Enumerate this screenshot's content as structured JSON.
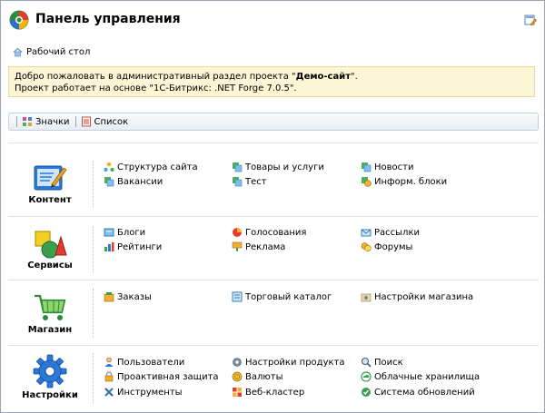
{
  "header": {
    "title": "Панель управления"
  },
  "breadcrumb": {
    "label": "Рабочий стол"
  },
  "notice": {
    "line1_prefix": "Добро пожаловать в административный раздел проекта \"",
    "project": "Демо-сайт",
    "line1_suffix": "\".",
    "line2": "Проект работает на основе \"1С-Битрикс: .NET Forge 7.0.5\"."
  },
  "toolbar": {
    "icons_label": "Значки",
    "list_label": "Список"
  },
  "sections": [
    {
      "label": "Контент",
      "items": [
        {
          "label": "Структура сайта",
          "icon": "structure-icon"
        },
        {
          "label": "Товары и услуги",
          "icon": "goods-icon"
        },
        {
          "label": "Новости",
          "icon": "news-icon"
        },
        {
          "label": "Вакансии",
          "icon": "vacancies-icon"
        },
        {
          "label": "Тест",
          "icon": "test-icon"
        },
        {
          "label": "Информ. блоки",
          "icon": "iblocks-icon"
        }
      ]
    },
    {
      "label": "Сервисы",
      "items": [
        {
          "label": "Блоги",
          "icon": "blogs-icon"
        },
        {
          "label": "Голосования",
          "icon": "votes-icon"
        },
        {
          "label": "Рассылки",
          "icon": "mailing-icon"
        },
        {
          "label": "Рейтинги",
          "icon": "ratings-icon"
        },
        {
          "label": "Реклама",
          "icon": "ads-icon"
        },
        {
          "label": "Форумы",
          "icon": "forums-icon"
        }
      ]
    },
    {
      "label": "Магазин",
      "items": [
        {
          "label": "Заказы",
          "icon": "orders-icon"
        },
        {
          "label": "Торговый каталог",
          "icon": "catalog-icon"
        },
        {
          "label": "Настройки магазина",
          "icon": "shop-settings-icon"
        }
      ]
    },
    {
      "label": "Настройки",
      "items": [
        {
          "label": "Пользователи",
          "icon": "users-icon"
        },
        {
          "label": "Настройки продукта",
          "icon": "product-settings-icon"
        },
        {
          "label": "Поиск",
          "icon": "search-icon"
        },
        {
          "label": "Проактивная защита",
          "icon": "security-icon"
        },
        {
          "label": "Валюты",
          "icon": "currency-icon"
        },
        {
          "label": "Облачные хранилища",
          "icon": "cloud-icon"
        },
        {
          "label": "Инструменты",
          "icon": "tools-icon"
        },
        {
          "label": "Веб-кластер",
          "icon": "cluster-icon"
        },
        {
          "label": "Система обновлений",
          "icon": "update-icon"
        }
      ]
    }
  ]
}
